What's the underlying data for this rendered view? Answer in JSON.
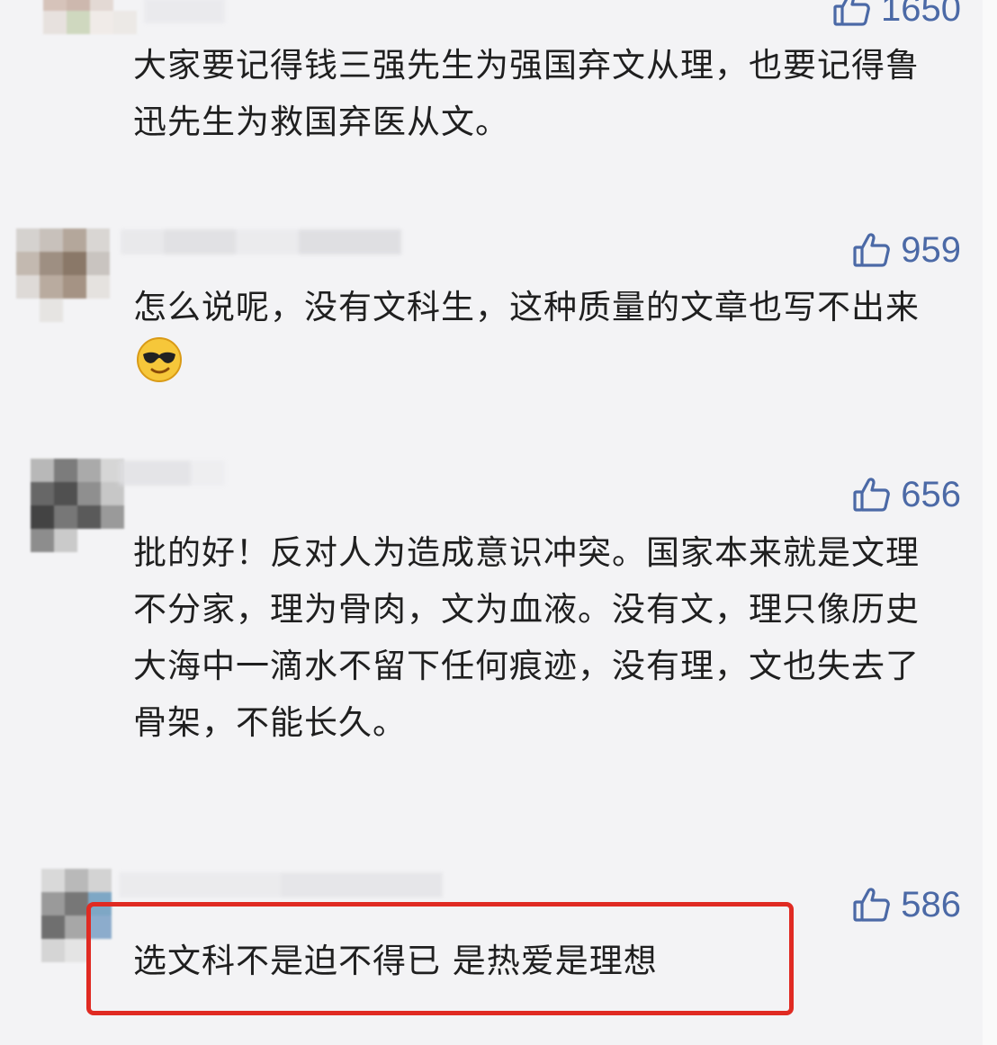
{
  "comments": [
    {
      "likes": "1650",
      "text": "大家要记得钱三强先生为强国弃文从理，也要记得鲁迅先生为救国弃医从文。"
    },
    {
      "likes": "959",
      "text": "怎么说呢，没有文科生，这种质量的文章也写不出来",
      "emoji": "cool-face-emoji"
    },
    {
      "likes": "656",
      "text": "批的好！反对人为造成意识冲突。国家本来就是文理不分家，理为骨肉，文为血液。没有文，理只像历史大海中一滴水不留下任何痕迹，没有理，文也失去了骨架，不能长久。"
    },
    {
      "likes": "586",
      "text": "选文科不是迫不得已 是热爱是理想"
    }
  ],
  "icons": {
    "like": "thumbs-up-icon"
  },
  "colors": {
    "background": "#f3f3f5",
    "text": "#1f1f1f",
    "like": "#4b69a6",
    "highlight": "#e02a22"
  }
}
